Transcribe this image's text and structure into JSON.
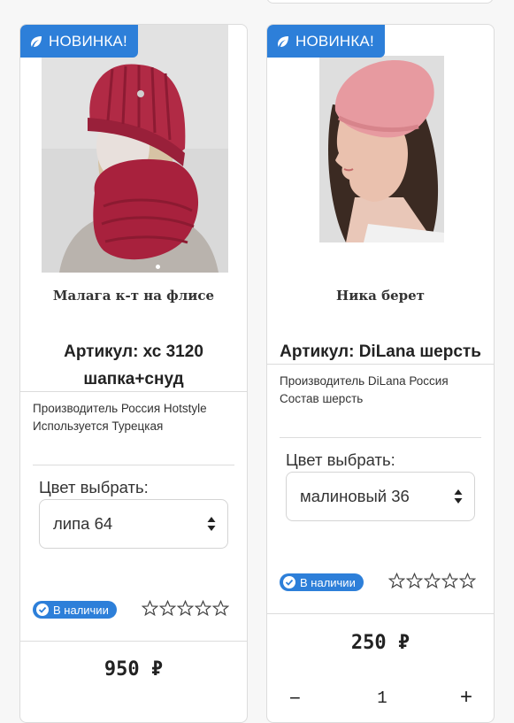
{
  "products": [
    {
      "badge": "НОВИНКА!",
      "title": "Малага к-т на флисе",
      "sku": "Артикул: хс 3120 шапка+снуд",
      "desc_line1": "Производитель Россия Hotstyle",
      "desc_line2": "Используется Турецкая",
      "color_label": "Цвет выбрать:",
      "color_value": "липа 64",
      "stock": "В наличии",
      "rating": 0,
      "price": "950 ₽"
    },
    {
      "badge": "НОВИНКА!",
      "title": "Ника берет",
      "sku": "Артикул: DiLana шерсть",
      "desc_line1": "Производитель DiLana Россия",
      "desc_line2": "Состав шерсть",
      "color_label": "Цвет выбрать:",
      "color_value": "малиновый 36",
      "stock": "В наличии",
      "rating": 0,
      "price": "250 ₽",
      "qty": {
        "minus": "−",
        "value": "1",
        "plus": "+"
      }
    }
  ],
  "colors": {
    "accent": "#2d7fd9",
    "hat_red": "#b12a45",
    "beret_pink": "#e79aa0"
  }
}
